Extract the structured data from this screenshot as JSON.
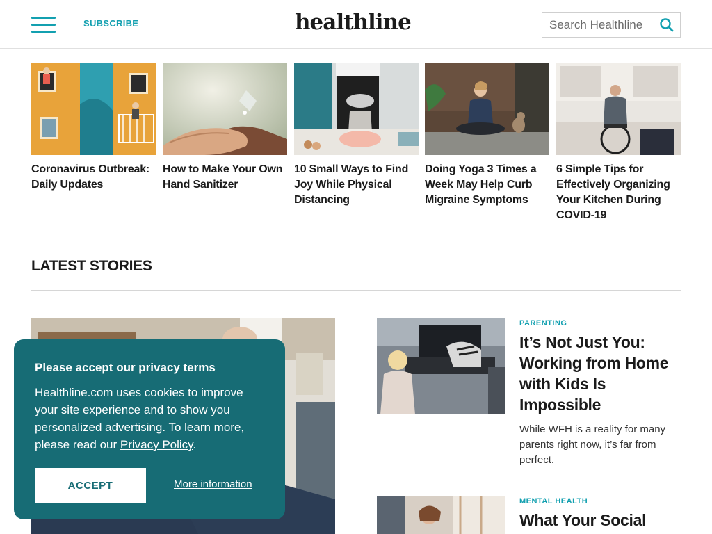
{
  "header": {
    "subscribe_label": "SUBSCRIBE",
    "logo_text": "healthline",
    "search_placeholder": "Search Healthline"
  },
  "top_stories": [
    {
      "title": "Coronavirus Outbreak: Daily Updates",
      "image": "houses-illustration"
    },
    {
      "title": "How to Make Your Own Hand Sanitizer",
      "image": "hand-sanitizer-photo"
    },
    {
      "title": "10 Small Ways to Find Joy While Physical Distancing",
      "image": "baking-photo"
    },
    {
      "title": "Doing Yoga 3 Times a Week May Help Curb Migraine Symptoms",
      "image": "yoga-photo"
    },
    {
      "title": "6 Simple Tips for Effectively Organizing Your Kitchen During COVID-19",
      "image": "kitchen-wheelchair-photo"
    }
  ],
  "latest": {
    "section_title": "LATEST STORIES",
    "stories": [
      {
        "category": "PARENTING",
        "title": "It’s Not Just You: Working from Home with Kids Is Impossible",
        "description": "While WFH is a reality for many parents right now, it’s far from perfect."
      },
      {
        "category": "MENTAL HEALTH",
        "title": "What Your Social",
        "description": ""
      }
    ]
  },
  "cookie_banner": {
    "title": "Please accept our privacy terms",
    "text_before_link": "Healthline.com uses cookies to improve your site experience and to show you personalized advertising. To learn more, please read our ",
    "link_text": "Privacy Policy",
    "text_after_link": ".",
    "accept_label": "ACCEPT",
    "more_info_label": "More information"
  },
  "colors": {
    "accent": "#13a0b0",
    "banner_bg": "#176c75",
    "text": "#1b1b1b"
  }
}
